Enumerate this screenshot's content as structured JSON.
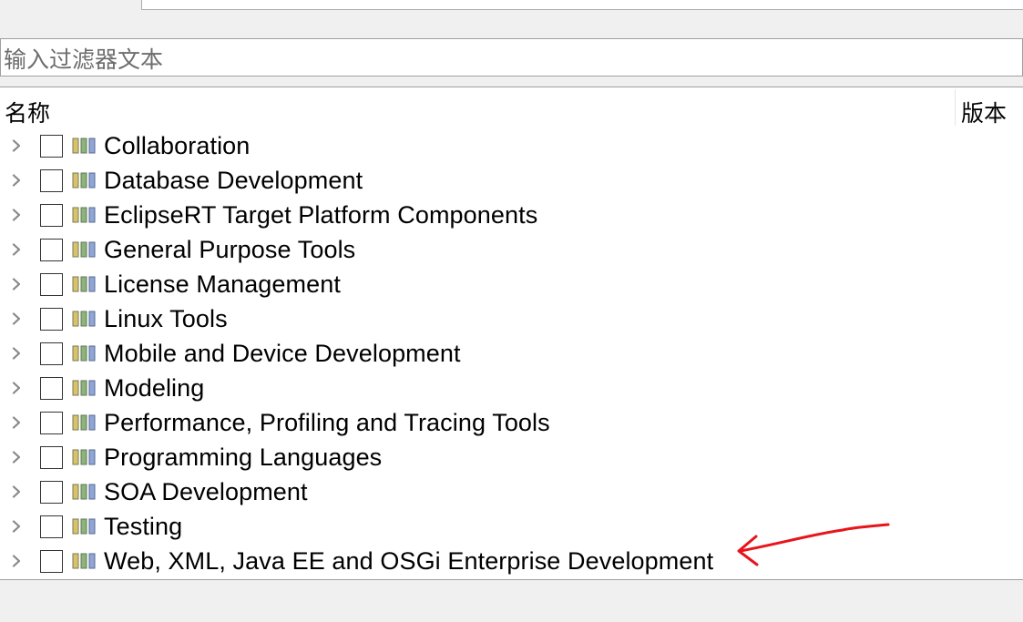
{
  "filter": {
    "placeholder": "输入过滤器文本"
  },
  "table": {
    "col_name": "名称",
    "col_version": "版本"
  },
  "categories": [
    "Collaboration",
    "Database Development",
    "EclipseRT Target Platform Components",
    "General Purpose Tools",
    "License Management",
    "Linux Tools",
    "Mobile and Device Development",
    "Modeling",
    "Performance, Profiling and Tracing Tools",
    "Programming Languages",
    "SOA Development",
    "Testing",
    "Web, XML, Java EE and OSGi Enterprise Development"
  ],
  "icons": {
    "expand": "chevron-right-icon",
    "category": "feature-category-icon"
  },
  "colors": {
    "annotation": "#e8141b",
    "chevron": "#888888"
  }
}
